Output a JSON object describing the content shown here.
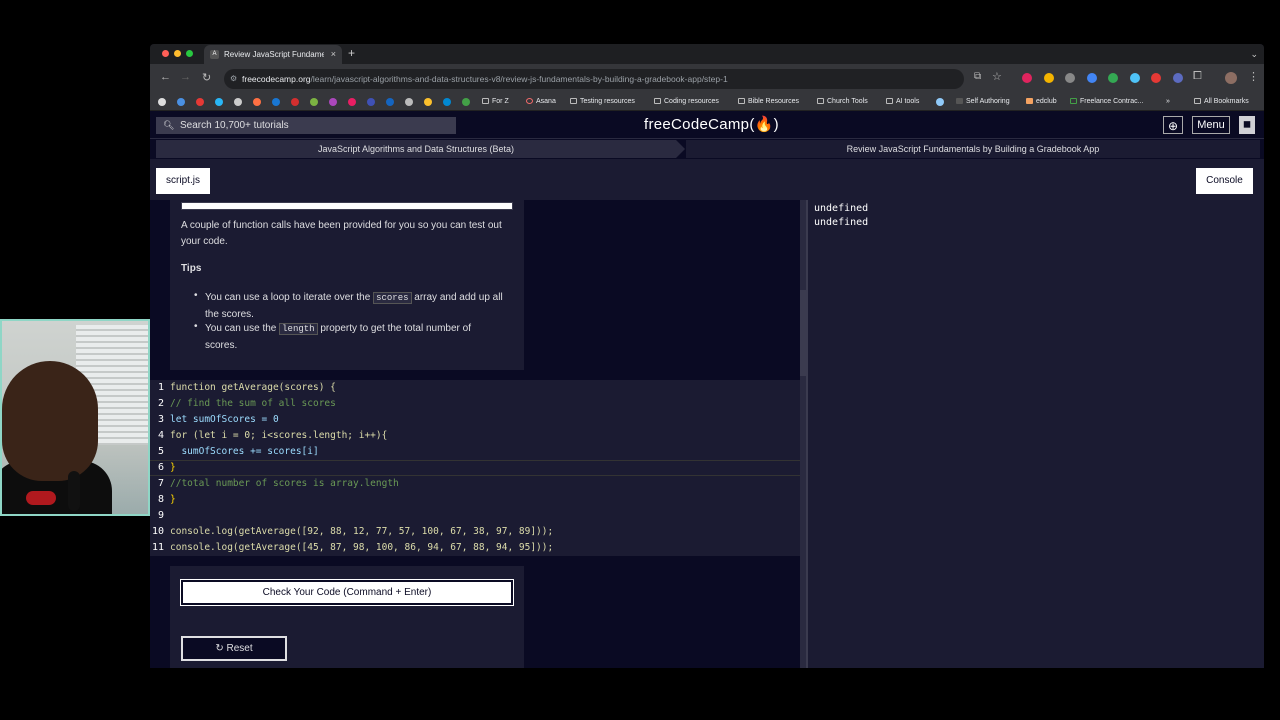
{
  "browser": {
    "tab_title": "Review JavaScript Fundame",
    "tab_close": "×",
    "new_tab": "+",
    "tab_menu": "⌄",
    "url_host": "freecodecamp.org",
    "url_path": "/learn/javascript-algorithms-and-data-structures-v8/review-js-fundamentals-by-building-a-gradebook-app/step-1",
    "bookmarks": [
      "For Z",
      "Asana",
      "Testing resources",
      "Coding resources",
      "Bible Resources",
      "Church Tools",
      "AI tools",
      "Self Authoring",
      "edclub",
      "Freelance Contrac...",
      "»",
      "All Bookmarks"
    ]
  },
  "nav": {
    "search_placeholder": "Search 10,700+ tutorials",
    "logo": "freeCodeCamp(🔥)",
    "menu_label": "Menu"
  },
  "breadcrumb": {
    "course": "JavaScript Algorithms and Data Structures (Beta)",
    "step": "Review JavaScript Fundamentals by Building a Gradebook App"
  },
  "tabs": {
    "file": "script.js",
    "console": "Console"
  },
  "instructions": {
    "paragraph": "A couple of function calls have been provided for you so you can test out your code.",
    "tips_heading": "Tips",
    "tip1_before": "You can use a loop to iterate over the ",
    "tip1_code": "scores",
    "tip1_after": " array and add up all the scores.",
    "tip2_before": "You can use the ",
    "tip2_code": "length",
    "tip2_after": " property to get the total number of scores."
  },
  "editor": {
    "line_numbers": [
      "1",
      "2",
      "3",
      "4",
      "5",
      "6",
      "7",
      "8",
      "9",
      "10",
      "11"
    ],
    "lines": [
      "function getAverage(scores) {",
      "// find the sum of all scores",
      "let sumOfScores = 0",
      "for (let i = 0; i<scores.length; i++){",
      "  sumOfScores += scores[i]",
      "}",
      "//total number of scores is array.length",
      "}",
      "",
      "console.log(getAverage([92, 88, 12, 77, 57, 100, 67, 38, 97, 89]));",
      "console.log(getAverage([45, 87, 98, 100, 86, 94, 67, 88, 94, 95]));"
    ]
  },
  "buttons": {
    "check": "Check Your Code (Command + Enter)",
    "reset": "Reset",
    "reset_icon": "↻"
  },
  "console": {
    "output": [
      "undefined",
      "undefined"
    ]
  }
}
